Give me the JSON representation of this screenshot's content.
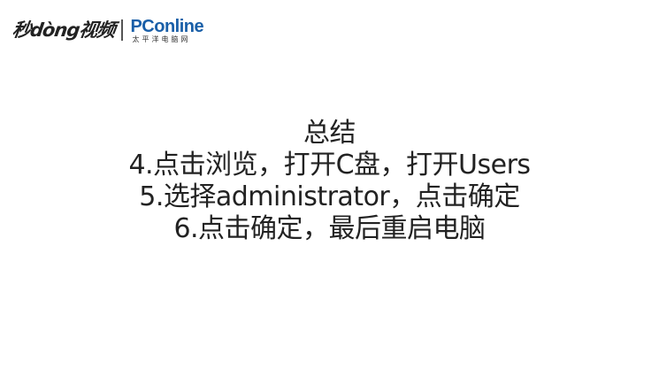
{
  "logos": {
    "miaodong": "秒dòng视频",
    "pconline": "PConline",
    "pconline_sub": "太平洋电脑网"
  },
  "summary": {
    "title": "总结",
    "lines": [
      "4.点击浏览，打开C盘，打开Users",
      "5.选择administrator，点击确定",
      "6.点击确定，最后重启电脑"
    ]
  }
}
